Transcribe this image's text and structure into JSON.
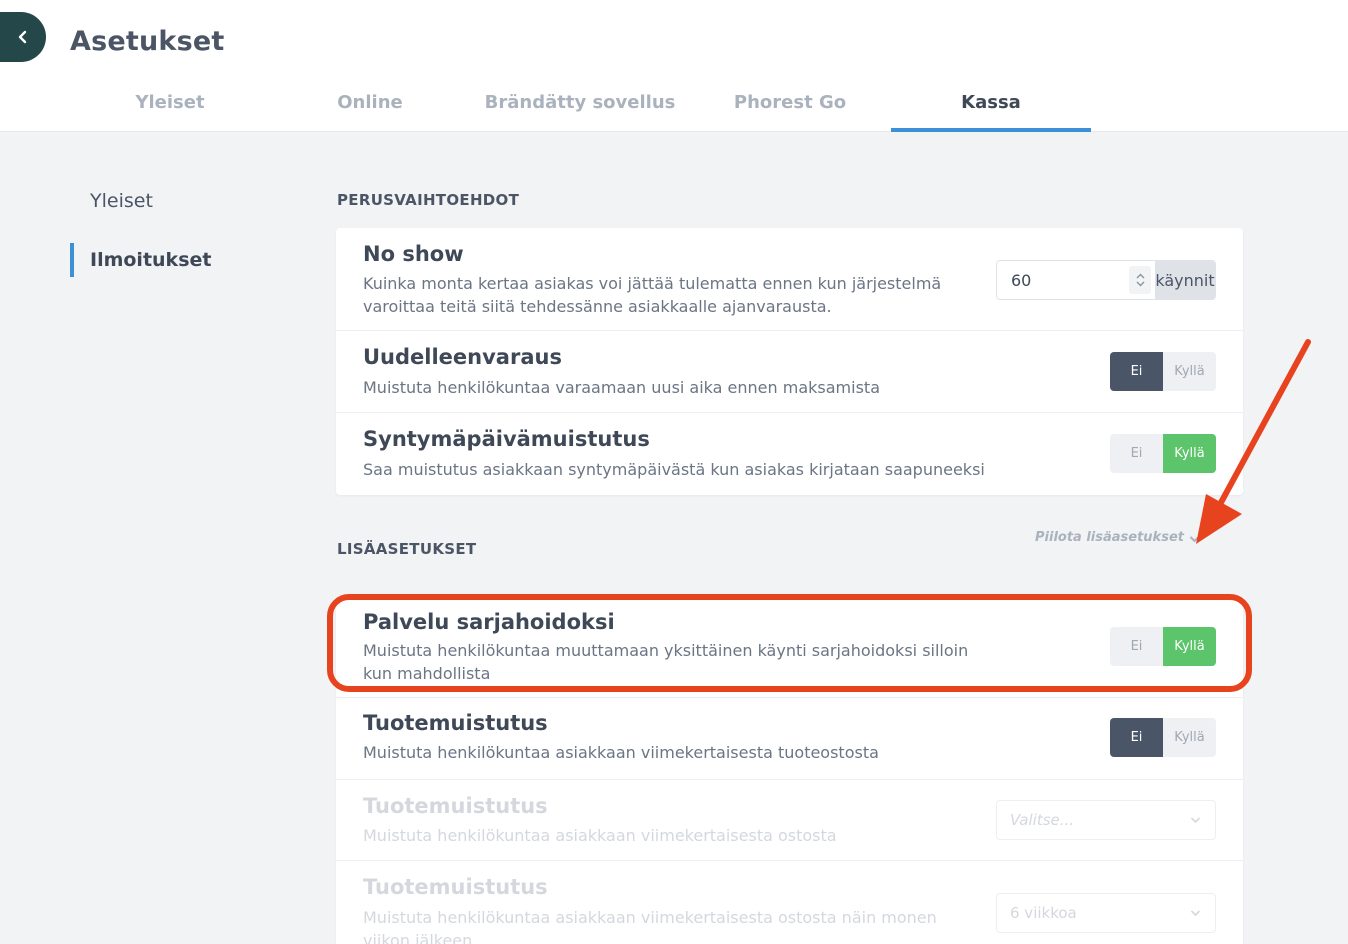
{
  "header": {
    "title": "Asetukset",
    "tabs": [
      {
        "label": "Yleiset"
      },
      {
        "label": "Online"
      },
      {
        "label": "Brändätty sovellus"
      },
      {
        "label": "Phorest Go"
      },
      {
        "label": "Kassa"
      }
    ],
    "active_tab": "Kassa"
  },
  "sidebar": {
    "items": [
      {
        "label": "Yleiset"
      },
      {
        "label": "Ilmoitukset"
      }
    ],
    "active": "Ilmoitukset"
  },
  "basic": {
    "title": "PERUSVAIHTOEHDOT",
    "no_show": {
      "title": "No show",
      "desc": "Kuinka monta kertaa asiakas voi jättää tulematta ennen kun järjestelmä varoittaa teitä siitä tehdessänne asiakkaalle ajanvarausta.",
      "value": "60",
      "unit": "käynnit"
    },
    "rebooking": {
      "title": "Uudelleenvaraus",
      "desc": "Muistuta henkilökuntaa varaamaan uusi aika ennen maksamista",
      "no": "Ei",
      "yes": "Kyllä",
      "selected": "Ei"
    },
    "birthday": {
      "title": "Syntymäpäivämuistutus",
      "desc": "Saa muistutus asiakkaan syntymäpäivästä kun asiakas kirjataan saapuneeksi",
      "no": "Ei",
      "yes": "Kyllä",
      "selected": "Kyllä"
    }
  },
  "advanced": {
    "title": "LISÄASETUKSET",
    "toggle_link": "Piilota lisäasetukset",
    "course": {
      "title": "Palvelu sarjahoidoksi",
      "desc": "Muistuta henkilökuntaa muuttamaan yksittäinen käynti sarjahoidoksi silloin kun mahdollista",
      "no": "Ei",
      "yes": "Kyllä",
      "selected": "Kyllä"
    },
    "product": {
      "title": "Tuotemuistutus",
      "desc": "Muistuta henkilökuntaa asiakkaan viimekertaisesta tuoteostosta",
      "no": "Ei",
      "yes": "Kyllä",
      "selected": "Ei"
    },
    "product_purchase": {
      "title": "Tuotemuistutus",
      "desc": "Muistuta henkilökuntaa asiakkaan viimekertaisesta ostosta",
      "placeholder": "Valitse..."
    },
    "product_weeks": {
      "title": "Tuotemuistutus",
      "desc": "Muistuta henkilökuntaa asiakkaan viimekertaisesta ostosta näin monen viikon jälkeen",
      "value": "6 viikkoa"
    }
  },
  "colors": {
    "accent": "#3d8fd6",
    "toggle_no": "#4a5568",
    "toggle_yes": "#5cc46a",
    "annotation": "#e8431f"
  }
}
